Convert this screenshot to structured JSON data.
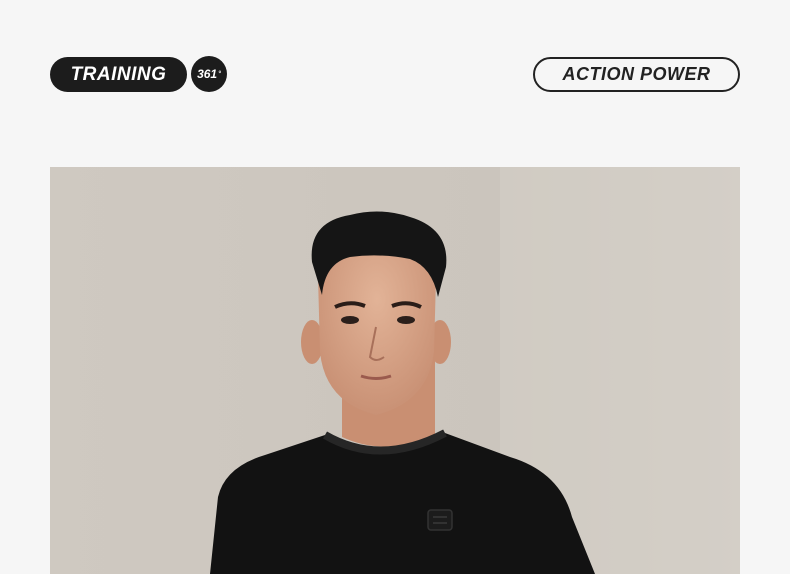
{
  "header": {
    "training_label": "TRAINING",
    "badge_label": "361",
    "badge_suffix": "°",
    "action_label": "ACTION POWER"
  },
  "photo": {
    "subject": "model-wearing-black-crew-neck-sweatshirt",
    "colors": {
      "background": "#cdc7bf",
      "shirt": "#121212",
      "skin": "#d9a88c",
      "hair": "#151515"
    }
  }
}
